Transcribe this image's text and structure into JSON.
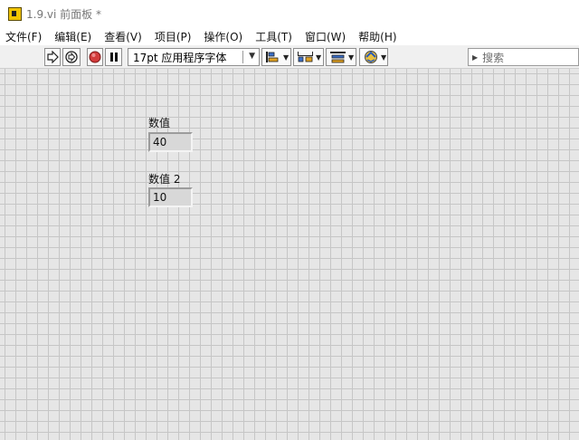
{
  "window": {
    "title": "1.9.vi 前面板 *"
  },
  "menu": [
    "文件(F)",
    "编辑(E)",
    "查看(V)",
    "项目(P)",
    "操作(O)",
    "工具(T)",
    "窗口(W)",
    "帮助(H)"
  ],
  "toolbar": {
    "font_select": "17pt 应用程序字体",
    "search_placeholder": "搜索",
    "icons": [
      "run-arrow-icon",
      "run-continuously-icon",
      "abort-icon",
      "pause-icon",
      "align-icon",
      "distribute-icon",
      "resize-icon",
      "reorder-icon"
    ]
  },
  "controls": [
    {
      "label": "数值",
      "value": "40"
    },
    {
      "label": "数值 2",
      "value": "10"
    }
  ],
  "colors": {
    "canvas": "#e6e6e6",
    "grid": "#c6c6c6",
    "abort": "#d23a3a"
  }
}
